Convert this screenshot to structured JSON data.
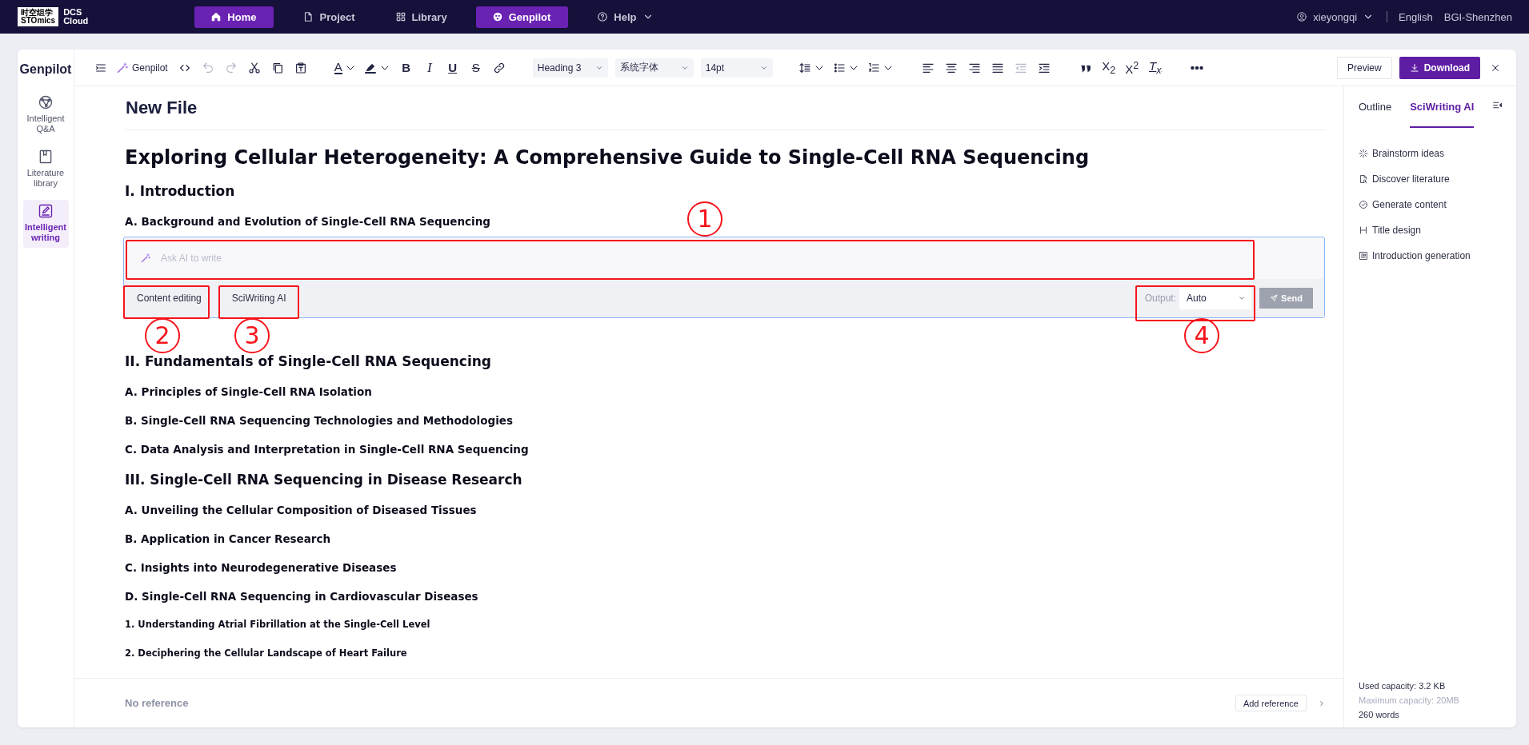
{
  "top_bar": {
    "logo": {
      "mark_lines": [
        "时空组学",
        "STOmics"
      ],
      "product_lines": [
        "DCS",
        "Cloud"
      ]
    },
    "nav": [
      {
        "label": "Home",
        "selected": true
      },
      {
        "label": "Project",
        "selected": false
      },
      {
        "label": "Library",
        "selected": false
      },
      {
        "label": "Genpilot",
        "selected": true
      },
      {
        "label": "Help",
        "selected": false,
        "dropdown": true
      }
    ],
    "user": "xieyongqi",
    "language": "English",
    "region": "BGI-Shenzhen"
  },
  "sidebar": {
    "title": "Genpilot",
    "items": [
      {
        "label": "Intelligent Q&A",
        "selected": false
      },
      {
        "label": "Literature library",
        "selected": false
      },
      {
        "label": "Intelligent writing",
        "selected": true
      }
    ]
  },
  "toolbar": {
    "items": [
      {
        "kind": "collapse"
      },
      {
        "kind": "assistant",
        "label": "Genpilot"
      },
      {
        "kind": "code"
      },
      {
        "kind": "undo",
        "disabled": true
      },
      {
        "kind": "redo",
        "disabled": true
      },
      {
        "kind": "cut"
      },
      {
        "kind": "copy"
      },
      {
        "kind": "paste"
      },
      {
        "kind": "fontcolor",
        "label": "A"
      },
      {
        "kind": "highlight"
      },
      {
        "kind": "bold",
        "label": "B"
      },
      {
        "kind": "italic",
        "label": "I"
      },
      {
        "kind": "underline",
        "label": "U"
      },
      {
        "kind": "strike",
        "label": "S"
      },
      {
        "kind": "link"
      },
      {
        "kind": "select",
        "value": "Heading 3"
      },
      {
        "kind": "select",
        "value": "系统字体"
      },
      {
        "kind": "select",
        "value": "14pt"
      },
      {
        "kind": "lineheight"
      },
      {
        "kind": "bullets"
      },
      {
        "kind": "numbers"
      },
      {
        "kind": "alignleft"
      },
      {
        "kind": "aligncenter"
      },
      {
        "kind": "alignright"
      },
      {
        "kind": "justify"
      },
      {
        "kind": "outdent",
        "disabled": true
      },
      {
        "kind": "indent",
        "disabled": false
      },
      {
        "kind": "quote"
      },
      {
        "kind": "subscript",
        "label": "X$_{2}$"
      },
      {
        "kind": "superscript",
        "label": "X$^{2}$"
      },
      {
        "kind": "clear",
        "label": "T$_{x}$"
      },
      {
        "kind": "more"
      }
    ],
    "preview": "Preview",
    "download": "Download"
  },
  "document": {
    "file_title": "New File",
    "blocks": [
      {
        "kind": "h1",
        "text": "Exploring Cellular Heterogeneity: A Comprehensive Guide to Single-Cell RNA Sequencing"
      },
      {
        "kind": "h2",
        "text": "I. Introduction"
      },
      {
        "kind": "h3",
        "text": "A. Background and Evolution of Single-Cell RNA Sequencing"
      },
      {
        "kind": "ai"
      },
      {
        "kind": "h2",
        "text": "II. Fundamentals of Single-Cell RNA Sequencing"
      },
      {
        "kind": "h3",
        "text": "A. Principles of Single-Cell RNA Isolation"
      },
      {
        "kind": "h3",
        "text": "B. Single-Cell RNA Sequencing Technologies and Methodologies"
      },
      {
        "kind": "h3",
        "text": "C. Data Analysis and Interpretation in Single-Cell RNA Sequencing"
      },
      {
        "kind": "h2",
        "text": "III. Single-Cell RNA Sequencing in Disease Research"
      },
      {
        "kind": "h3",
        "text": "A. Unveiling the Cellular Composition of Diseased Tissues"
      },
      {
        "kind": "h3",
        "text": "B. Application in Cancer Research"
      },
      {
        "kind": "h3",
        "text": "C. Insights into Neurodegenerative Diseases"
      },
      {
        "kind": "h3",
        "text": "D. Single-Cell RNA Sequencing in Cardiovascular Diseases"
      },
      {
        "kind": "h4",
        "text": "1. Understanding Atrial Fibrillation at the Single-Cell Level"
      },
      {
        "kind": "h4",
        "text": "2. Deciphering the Cellular Landscape of Heart Failure"
      }
    ],
    "footer": {
      "references": "No reference",
      "add_button": "Add reference"
    }
  },
  "ai_prompt": {
    "placeholder": "Ask AI to write",
    "modes": [
      "Content editing",
      "SciWriting AI"
    ],
    "output_label": "Output:",
    "output_value": "Auto",
    "send": "Send",
    "send_disabled": true
  },
  "annotations": [
    "1",
    "2",
    "3",
    "4"
  ],
  "right_panel": {
    "tabs": [
      {
        "label": "Outline",
        "selected": false
      },
      {
        "label": "SciWriting AI",
        "selected": true
      }
    ],
    "items": [
      "Brainstorm ideas",
      "Discover literature",
      "Generate content",
      "Title design",
      "Introduction generation"
    ],
    "used_capacity": "Used capacity: 3.2 KB",
    "max_capacity": "Maximum capacity: 20MB",
    "words": "260 words"
  }
}
